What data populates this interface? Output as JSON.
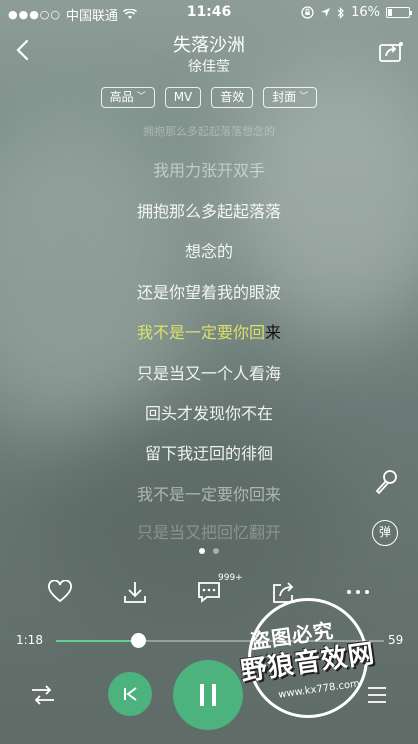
{
  "status_bar": {
    "carrier": "中国联通",
    "time": "11:46",
    "battery": "16%"
  },
  "header": {
    "song_title": "失落沙洲",
    "artist": "徐佳莹"
  },
  "pills": [
    {
      "label": "高品",
      "has_chevron": true
    },
    {
      "label": "MV",
      "has_chevron": false
    },
    {
      "label": "音效",
      "has_chevron": false
    },
    {
      "label": "封面",
      "has_chevron": true
    }
  ],
  "lyrics": {
    "faded_top": "拥抱那么多起起落落想念的",
    "line1": "我用力张开双手",
    "line2": "拥抱那么多起起落落",
    "line3": "想念的",
    "line4": "还是你望着我的眼波",
    "current_sung": "我不是一定要你回",
    "current_rest": "来",
    "line6": "只是当又一个人看海",
    "line7": "回头才发现你不在",
    "line8": "留下我迂回的徘徊",
    "line9": "我不是一定要你回来",
    "line10": "只是当又把回忆翻开"
  },
  "side": {
    "danmu_label": "弹"
  },
  "actions": {
    "comment_count": "999+"
  },
  "progress": {
    "elapsed": "1:18",
    "total_partial": "59",
    "fraction": 0.25
  },
  "watermark": {
    "top": "盗图必究",
    "main": "野狼音效网",
    "url": "www.kx778.com"
  },
  "colors": {
    "accent": "#4cb27e",
    "current_lyric": "#d9e36a"
  },
  "icons": {
    "back": "chevron-left-icon",
    "mv_share": "video-share-icon",
    "like": "heart-icon",
    "download": "download-icon",
    "comment": "comment-icon",
    "share": "share-icon",
    "more": "more-icon",
    "repeat": "shuffle-icon",
    "prev": "previous-icon",
    "pause": "pause-icon",
    "playlist": "playlist-icon",
    "mic": "microphone-icon"
  }
}
